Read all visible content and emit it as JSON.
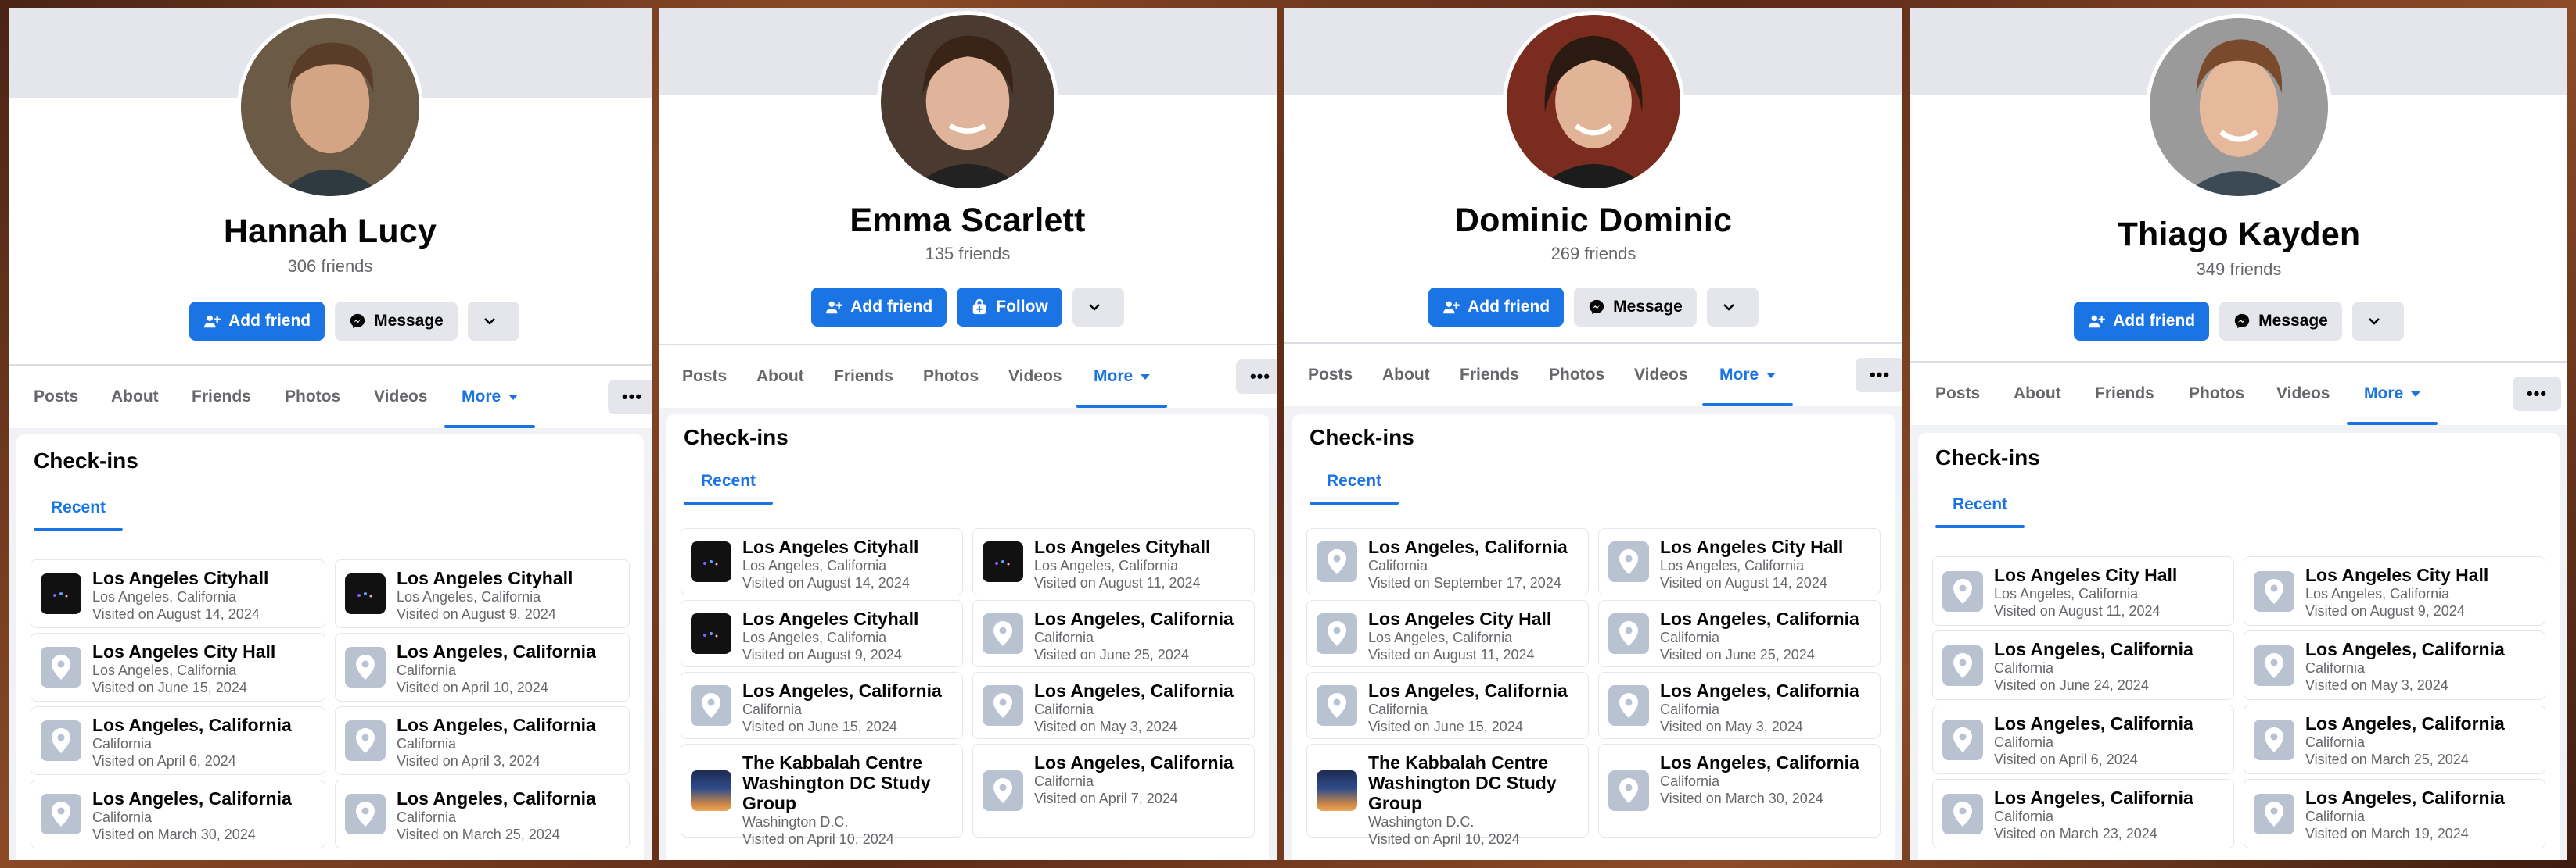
{
  "profiles": [
    {
      "name": "Hannah Lucy",
      "friends": "306 friends",
      "primary_button": "Add friend",
      "secondary_button": "Message",
      "section_title": "Check-ins",
      "subtab": "Recent",
      "tabs": [
        "Posts",
        "About",
        "Friends",
        "Photos",
        "Videos",
        "More"
      ],
      "checkins": [
        {
          "title": "Los Angeles Cityhall",
          "location": "Los Angeles, California",
          "visited": "Visited on August 14, 2024",
          "thumb": "night-city-photo"
        },
        {
          "title": "Los Angeles Cityhall",
          "location": "Los Angeles, California",
          "visited": "Visited on August 9, 2024",
          "thumb": "night-city-photo"
        },
        {
          "title": "Los Angeles City Hall",
          "location": "Los Angeles, California",
          "visited": "Visited on June 15, 2024",
          "thumb": "map-pin-icon"
        },
        {
          "title": "Los Angeles, California",
          "location": "California",
          "visited": "Visited on April 10, 2024",
          "thumb": "map-pin-icon"
        },
        {
          "title": "Los Angeles, California",
          "location": "California",
          "visited": "Visited on April 6, 2024",
          "thumb": "map-pin-icon"
        },
        {
          "title": "Los Angeles, California",
          "location": "California",
          "visited": "Visited on April 3, 2024",
          "thumb": "map-pin-icon"
        },
        {
          "title": "Los Angeles, California",
          "location": "California",
          "visited": "Visited on March 30, 2024",
          "thumb": "map-pin-icon"
        },
        {
          "title": "Los Angeles, California",
          "location": "California",
          "visited": "Visited on March 25, 2024",
          "thumb": "map-pin-icon"
        }
      ]
    },
    {
      "name": "Emma Scarlett",
      "friends": "135 friends",
      "primary_button": "Add friend",
      "secondary_button": "Follow",
      "section_title": "Check-ins",
      "subtab": "Recent",
      "tabs": [
        "Posts",
        "About",
        "Friends",
        "Photos",
        "Videos",
        "More"
      ],
      "checkins": [
        {
          "title": "Los Angeles Cityhall",
          "location": "Los Angeles, California",
          "visited": "Visited on August 14, 2024",
          "thumb": "night-city-photo"
        },
        {
          "title": "Los Angeles Cityhall",
          "location": "Los Angeles, California",
          "visited": "Visited on August 11, 2024",
          "thumb": "night-city-photo"
        },
        {
          "title": "Los Angeles Cityhall",
          "location": "Los Angeles, California",
          "visited": "Visited on August 9, 2024",
          "thumb": "night-city-photo"
        },
        {
          "title": "Los Angeles, California",
          "location": "California",
          "visited": "Visited on June 25, 2024",
          "thumb": "map-pin-icon"
        },
        {
          "title": "Los Angeles, California",
          "location": "California",
          "visited": "Visited on June 15, 2024",
          "thumb": "map-pin-icon"
        },
        {
          "title": "Los Angeles, California",
          "location": "California",
          "visited": "Visited on May 3, 2024",
          "thumb": "map-pin-icon"
        },
        {
          "title": "The Kabbalah Centre Washington DC Study Group",
          "location": "Washington D.C.",
          "visited": "Visited on April 10, 2024",
          "thumb": "kabbalah-photo"
        },
        {
          "title": "Los Angeles, California",
          "location": "California",
          "visited": "Visited on April 7, 2024",
          "thumb": "map-pin-icon"
        }
      ]
    },
    {
      "name": "Dominic Dominic",
      "friends": "269 friends",
      "primary_button": "Add friend",
      "secondary_button": "Message",
      "section_title": "Check-ins",
      "subtab": "Recent",
      "tabs": [
        "Posts",
        "About",
        "Friends",
        "Photos",
        "Videos",
        "More"
      ],
      "checkins": [
        {
          "title": "Los Angeles, California",
          "location": "California",
          "visited": "Visited on September 17, 2024",
          "thumb": "map-pin-icon"
        },
        {
          "title": "Los Angeles City Hall",
          "location": "Los Angeles, California",
          "visited": "Visited on August 14, 2024",
          "thumb": "map-pin-icon"
        },
        {
          "title": "Los Angeles City Hall",
          "location": "Los Angeles, California",
          "visited": "Visited on August 11, 2024",
          "thumb": "map-pin-icon"
        },
        {
          "title": "Los Angeles, California",
          "location": "California",
          "visited": "Visited on June 25, 2024",
          "thumb": "map-pin-icon"
        },
        {
          "title": "Los Angeles, California",
          "location": "California",
          "visited": "Visited on June 15, 2024",
          "thumb": "map-pin-icon"
        },
        {
          "title": "Los Angeles, California",
          "location": "California",
          "visited": "Visited on May 3, 2024",
          "thumb": "map-pin-icon"
        },
        {
          "title": "The Kabbalah Centre Washington DC Study Group",
          "location": "Washington D.C.",
          "visited": "Visited on April 10, 2024",
          "thumb": "kabbalah-photo"
        },
        {
          "title": "Los Angeles, California",
          "location": "California",
          "visited": "Visited on March 30, 2024",
          "thumb": "map-pin-icon"
        }
      ]
    },
    {
      "name": "Thiago Kayden",
      "friends": "349 friends",
      "primary_button": "Add friend",
      "secondary_button": "Message",
      "section_title": "Check-ins",
      "subtab": "Recent",
      "tabs": [
        "Posts",
        "About",
        "Friends",
        "Photos",
        "Videos",
        "More"
      ],
      "checkins": [
        {
          "title": "Los Angeles City Hall",
          "location": "Los Angeles, California",
          "visited": "Visited on August 11, 2024",
          "thumb": "map-pin-icon"
        },
        {
          "title": "Los Angeles City Hall",
          "location": "Los Angeles, California",
          "visited": "Visited on August 9, 2024",
          "thumb": "map-pin-icon"
        },
        {
          "title": "Los Angeles, California",
          "location": "California",
          "visited": "Visited on June 24, 2024",
          "thumb": "map-pin-icon"
        },
        {
          "title": "Los Angeles, California",
          "location": "California",
          "visited": "Visited on May 3, 2024",
          "thumb": "map-pin-icon"
        },
        {
          "title": "Los Angeles, California",
          "location": "California",
          "visited": "Visited on April 6, 2024",
          "thumb": "map-pin-icon"
        },
        {
          "title": "Los Angeles, California",
          "location": "California",
          "visited": "Visited on March 25, 2024",
          "thumb": "map-pin-icon"
        },
        {
          "title": "Los Angeles, California",
          "location": "California",
          "visited": "Visited on March 23, 2024",
          "thumb": "map-pin-icon"
        },
        {
          "title": "Los Angeles, California",
          "location": "California",
          "visited": "Visited on March 19, 2024",
          "thumb": "map-pin-icon"
        }
      ]
    }
  ],
  "colors": {
    "accent": "#1b74e4",
    "secondary_button": "#e4e6eb",
    "muted_text": "#65676b"
  }
}
